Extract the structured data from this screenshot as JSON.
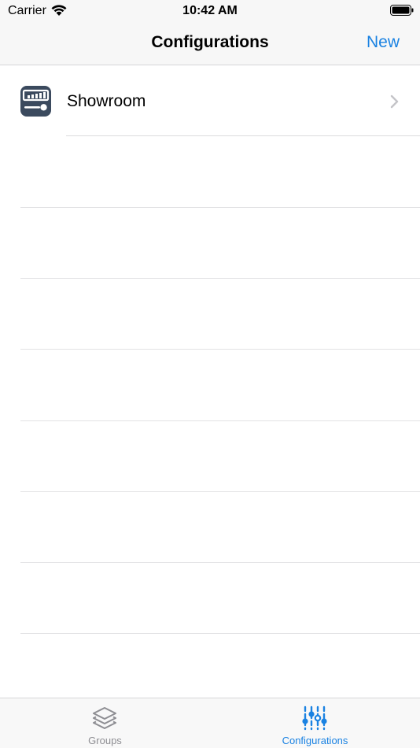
{
  "status_bar": {
    "carrier": "Carrier",
    "time": "10:42 AM",
    "wifi_icon": "wifi-icon",
    "battery_icon": "battery-icon"
  },
  "nav": {
    "title": "Configurations",
    "new_label": "New"
  },
  "list": {
    "items": [
      {
        "label": "Showroom",
        "icon": "configuration-icon",
        "accessory": "chevron-right-icon"
      }
    ]
  },
  "tab_bar": {
    "tabs": [
      {
        "label": "Groups",
        "icon": "layers-icon",
        "selected": false
      },
      {
        "label": "Configurations",
        "icon": "sliders-icon",
        "selected": true
      }
    ]
  },
  "colors": {
    "accent": "#1a82e2",
    "icon_background": "#3b4a5e",
    "inactive_tab": "#8e8e93",
    "separator": "#dcdcde"
  }
}
